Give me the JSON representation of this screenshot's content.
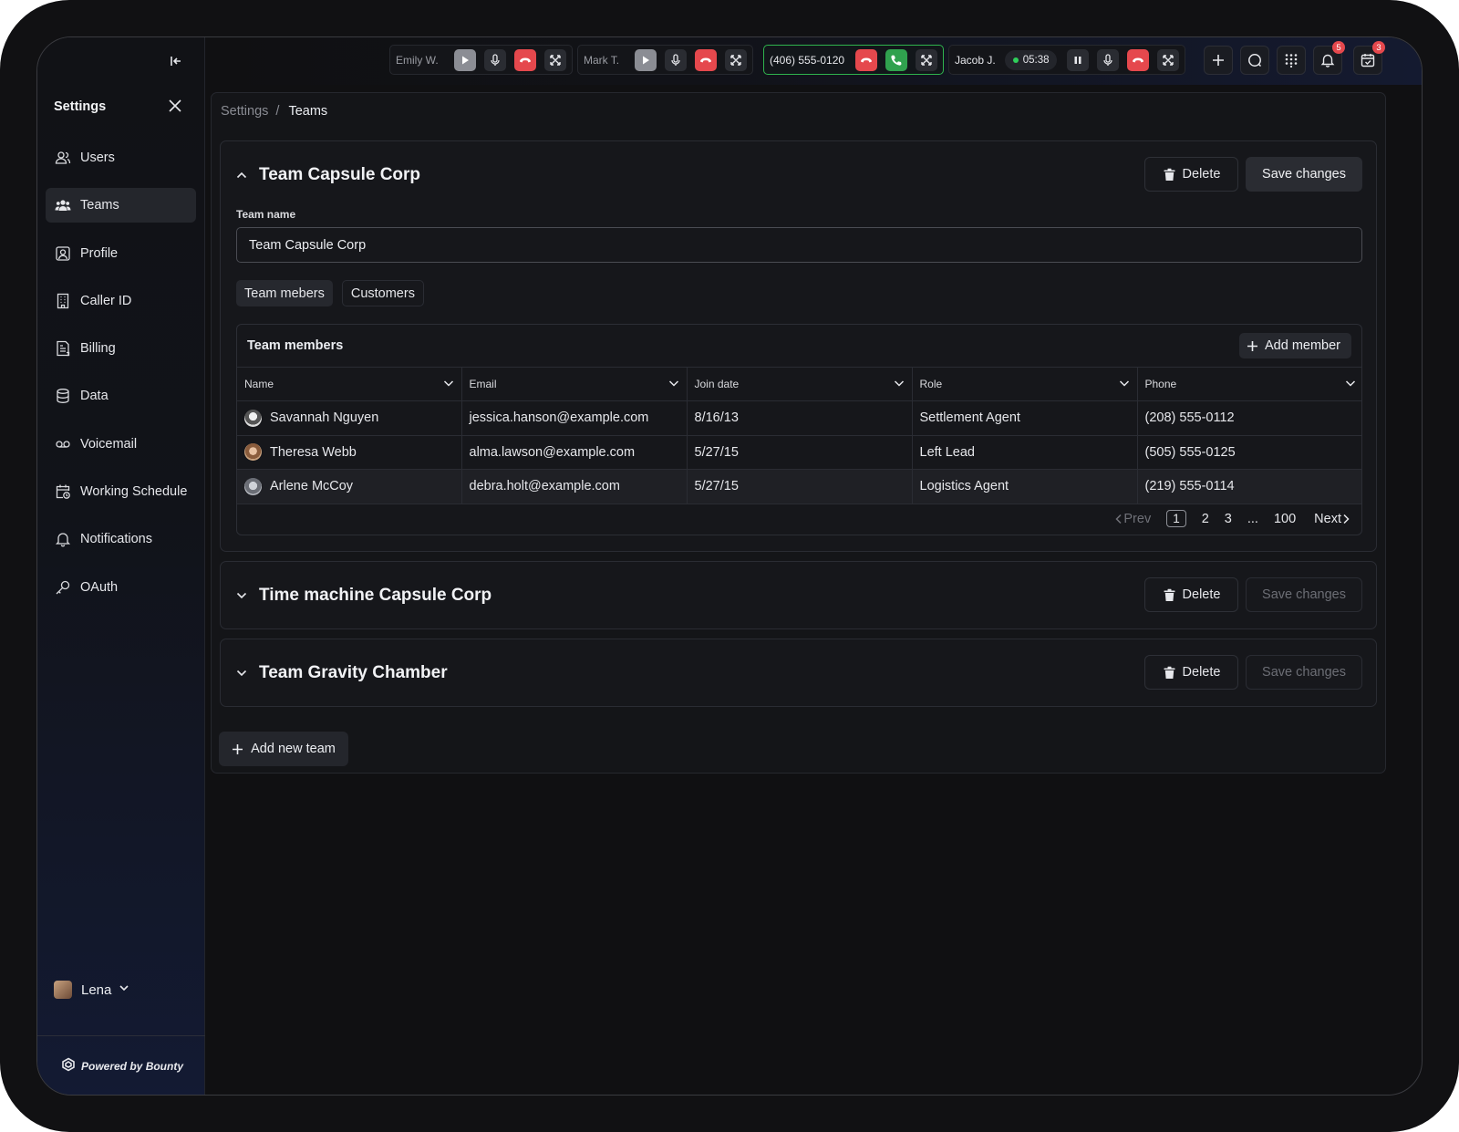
{
  "sidebar": {
    "title": "Settings",
    "items": [
      {
        "label": "Users",
        "icon": "users-icon"
      },
      {
        "label": "Teams",
        "icon": "teams-icon"
      },
      {
        "label": "Profile",
        "icon": "profile-icon"
      },
      {
        "label": "Caller ID",
        "icon": "building-icon"
      },
      {
        "label": "Billing",
        "icon": "billing-icon"
      },
      {
        "label": "Data",
        "icon": "database-icon"
      },
      {
        "label": "Voicemail",
        "icon": "voicemail-icon"
      },
      {
        "label": "Working Schedule",
        "icon": "calendar-clock-icon"
      },
      {
        "label": "Notifications",
        "icon": "bell-icon"
      },
      {
        "label": "OAuth",
        "icon": "key-icon"
      }
    ],
    "active_item": "Teams",
    "user": {
      "name": "Lena"
    },
    "powered_by": "Powered by Bounty"
  },
  "topbar": {
    "calls": [
      {
        "name": "Emily W."
      },
      {
        "name": "Mark T."
      },
      {
        "name": "(406) 555-0120"
      },
      {
        "name": "Jacob J.",
        "timer": "05:38"
      }
    ],
    "notifications_count": "5",
    "calendar_count": "3"
  },
  "breadcrumb": {
    "parent": "Settings",
    "separator": "/",
    "current": "Teams"
  },
  "teams": [
    {
      "title": "Team Capsule Corp",
      "expanded": true,
      "delete_label": "Delete",
      "save_label": "Save changes",
      "field_label": "Team name",
      "field_value": "Team Capsule Corp",
      "tabs": [
        "Team mebers",
        "Customers"
      ],
      "members": {
        "title": "Team members",
        "add_label": "Add member",
        "columns": [
          "Name",
          "Email",
          "Join date",
          "Role",
          "Phone"
        ],
        "rows": [
          {
            "name": "Savannah Nguyen",
            "email": "jessica.hanson@example.com",
            "join": "8/16/13",
            "role": "Settlement Agent",
            "phone": "(208) 555-0112"
          },
          {
            "name": "Theresa Webb",
            "email": "alma.lawson@example.com",
            "join": "5/27/15",
            "role": "Left Lead",
            "phone": "(505) 555-0125"
          },
          {
            "name": "Arlene McCoy",
            "email": "debra.holt@example.com",
            "join": "5/27/15",
            "role": "Logistics Agent",
            "phone": "(219) 555-0114"
          }
        ],
        "pagination": {
          "prev": "Prev",
          "pages": [
            "1",
            "2",
            "3",
            "...",
            "100"
          ],
          "current": "1",
          "next": "Next"
        }
      }
    },
    {
      "title": "Time machine Capsule Corp",
      "expanded": false,
      "delete_label": "Delete",
      "save_label": "Save changes"
    },
    {
      "title": "Team Gravity Chamber",
      "expanded": false,
      "delete_label": "Delete",
      "save_label": "Save changes"
    }
  ],
  "add_team_label": "Add new team",
  "colors": {
    "accent_green": "#30a14e",
    "danger_red": "#e5484d",
    "background": "#101012"
  }
}
